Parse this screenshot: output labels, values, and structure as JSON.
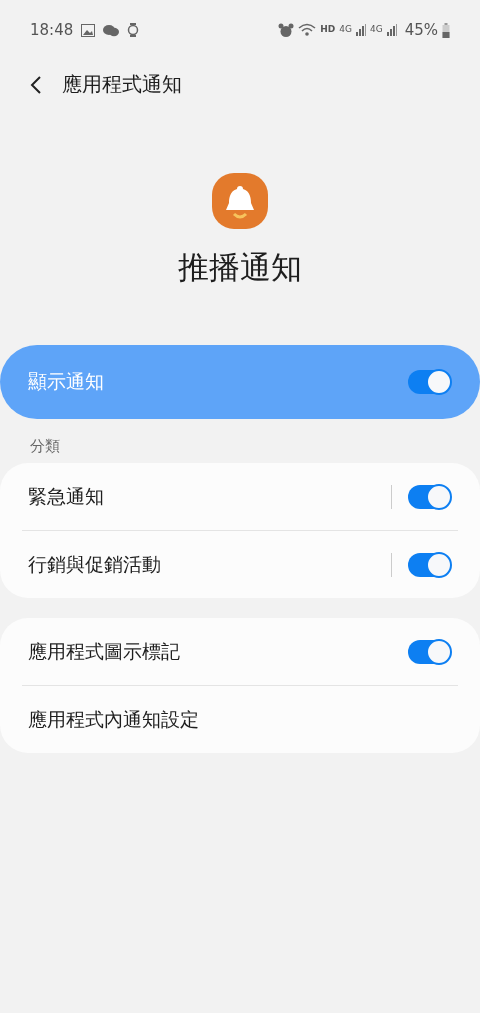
{
  "status_bar": {
    "time": "18:48",
    "network": "HD",
    "signal_labels": [
      "4G",
      "4G"
    ],
    "battery": "45%"
  },
  "header": {
    "title": "應用程式通知"
  },
  "app": {
    "name": "推播通知"
  },
  "master": {
    "label": "顯示通知",
    "on": true
  },
  "sections": [
    {
      "title": "分類",
      "items": [
        {
          "kind": "switch",
          "label": "緊急通知",
          "on": true,
          "divider": true
        },
        {
          "kind": "switch",
          "label": "行銷與促銷活動",
          "on": true,
          "divider": true
        }
      ]
    },
    {
      "items": [
        {
          "kind": "switch",
          "label": "應用程式圖示標記",
          "on": true,
          "divider": false
        },
        {
          "kind": "link",
          "label": "應用程式內通知設定"
        }
      ]
    }
  ]
}
